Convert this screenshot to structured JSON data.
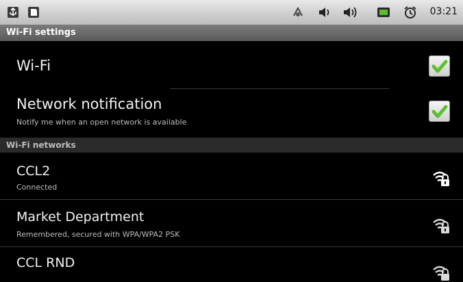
{
  "status_bar": {
    "time": "03:21",
    "icons": [
      "usb-icon",
      "sd-card-icon",
      "debug-icon",
      "volume-icon",
      "volume-icon",
      "battery-icon",
      "alarm-clock-icon"
    ]
  },
  "title": "Wi-Fi settings",
  "wifi": {
    "label": "Wi-Fi",
    "checked": true
  },
  "notification": {
    "label": "Network notification",
    "summary": "Notify me when an open network is available",
    "checked": true
  },
  "networks_header": "Wi-Fi networks",
  "networks": [
    {
      "name": "CCL2",
      "status": "Connected",
      "icon": "wifi-locked-icon"
    },
    {
      "name": "Market Department",
      "status": "Remembered, secured with WPA/WPA2 PSK",
      "icon": "wifi-locked-icon"
    },
    {
      "name": "CCL RND",
      "status": "",
      "icon": "wifi-locked-icon"
    }
  ],
  "colors": {
    "checkmark": "#5cc02e",
    "background": "#000000",
    "section_header": "#2b2b2b"
  }
}
